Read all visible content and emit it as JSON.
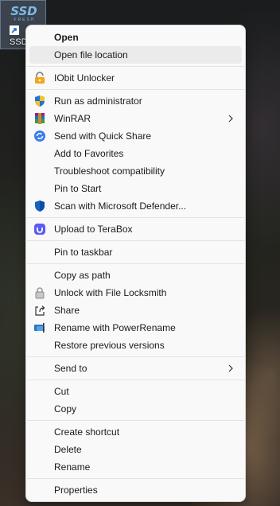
{
  "desktop": {
    "shortcut_name": "SSD",
    "shortcut_logo_text": "SSD",
    "shortcut_logo_sub": "FRESH"
  },
  "context_menu": {
    "groups": [
      [
        {
          "label": "Open",
          "bold": true
        },
        {
          "label": "Open file location",
          "highlighted": true
        }
      ],
      [
        {
          "label": "IObit Unlocker",
          "icon": "iobit-unlocker-icon"
        }
      ],
      [
        {
          "label": "Run as administrator",
          "icon": "uac-shield-icon"
        },
        {
          "label": "WinRAR",
          "icon": "winrar-icon",
          "submenu": true
        },
        {
          "label": "Send with Quick Share",
          "icon": "quick-share-icon"
        },
        {
          "label": "Add to Favorites"
        },
        {
          "label": "Troubleshoot compatibility"
        },
        {
          "label": "Pin to Start"
        },
        {
          "label": "Scan with Microsoft Defender...",
          "icon": "defender-shield-icon"
        }
      ],
      [
        {
          "label": "Upload to TeraBox",
          "icon": "terabox-icon"
        }
      ],
      [
        {
          "label": "Pin to taskbar"
        }
      ],
      [
        {
          "label": "Copy as path"
        },
        {
          "label": "Unlock with File Locksmith",
          "icon": "lock-icon"
        },
        {
          "label": "Share",
          "icon": "share-icon"
        },
        {
          "label": "Rename with PowerRename",
          "icon": "powerrename-icon"
        },
        {
          "label": "Restore previous versions"
        }
      ],
      [
        {
          "label": "Send to",
          "submenu": true
        }
      ],
      [
        {
          "label": "Cut"
        },
        {
          "label": "Copy"
        }
      ],
      [
        {
          "label": "Create shortcut"
        },
        {
          "label": "Delete"
        },
        {
          "label": "Rename"
        }
      ],
      [
        {
          "label": "Properties"
        }
      ]
    ]
  },
  "colors": {
    "menu_background": "#f9f9f9",
    "hover_background": "#ebebeb",
    "separator": "#e3e3e3",
    "text": "#1a1a1a"
  }
}
